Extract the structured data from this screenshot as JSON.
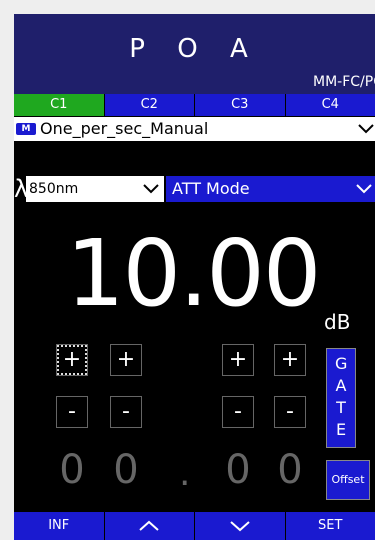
{
  "header": {
    "title": "P O A",
    "subtitle": "MM-FC/PC"
  },
  "tabs": [
    {
      "label": "C1",
      "active": true
    },
    {
      "label": "C2",
      "active": false
    },
    {
      "label": "C3",
      "active": false
    },
    {
      "label": "C4",
      "active": false
    }
  ],
  "mode_row": {
    "badge": "M",
    "label": "One_per_sec_Manual",
    "icon": "chevron-down-icon"
  },
  "wavelength": {
    "symbol": "λ",
    "value": "850nm",
    "icon": "chevron-down-icon"
  },
  "att_mode": {
    "label": "ATT Mode",
    "icon": "chevron-down-icon"
  },
  "display": {
    "value": "10.00",
    "unit": "dB"
  },
  "digits": [
    "0",
    "0",
    ".",
    "0",
    "0"
  ],
  "buttons": {
    "plus": "+",
    "minus": "-"
  },
  "side": {
    "gate": "GATE",
    "offset": "Offset"
  },
  "bottom_bar": {
    "inf": "INF",
    "set": "SET",
    "up_icon": "chevron-up-icon",
    "down_icon": "chevron-down-icon"
  },
  "colors": {
    "header": "#1f1f6b",
    "accent": "#1a1ad0",
    "active_tab": "#1fa81f"
  }
}
